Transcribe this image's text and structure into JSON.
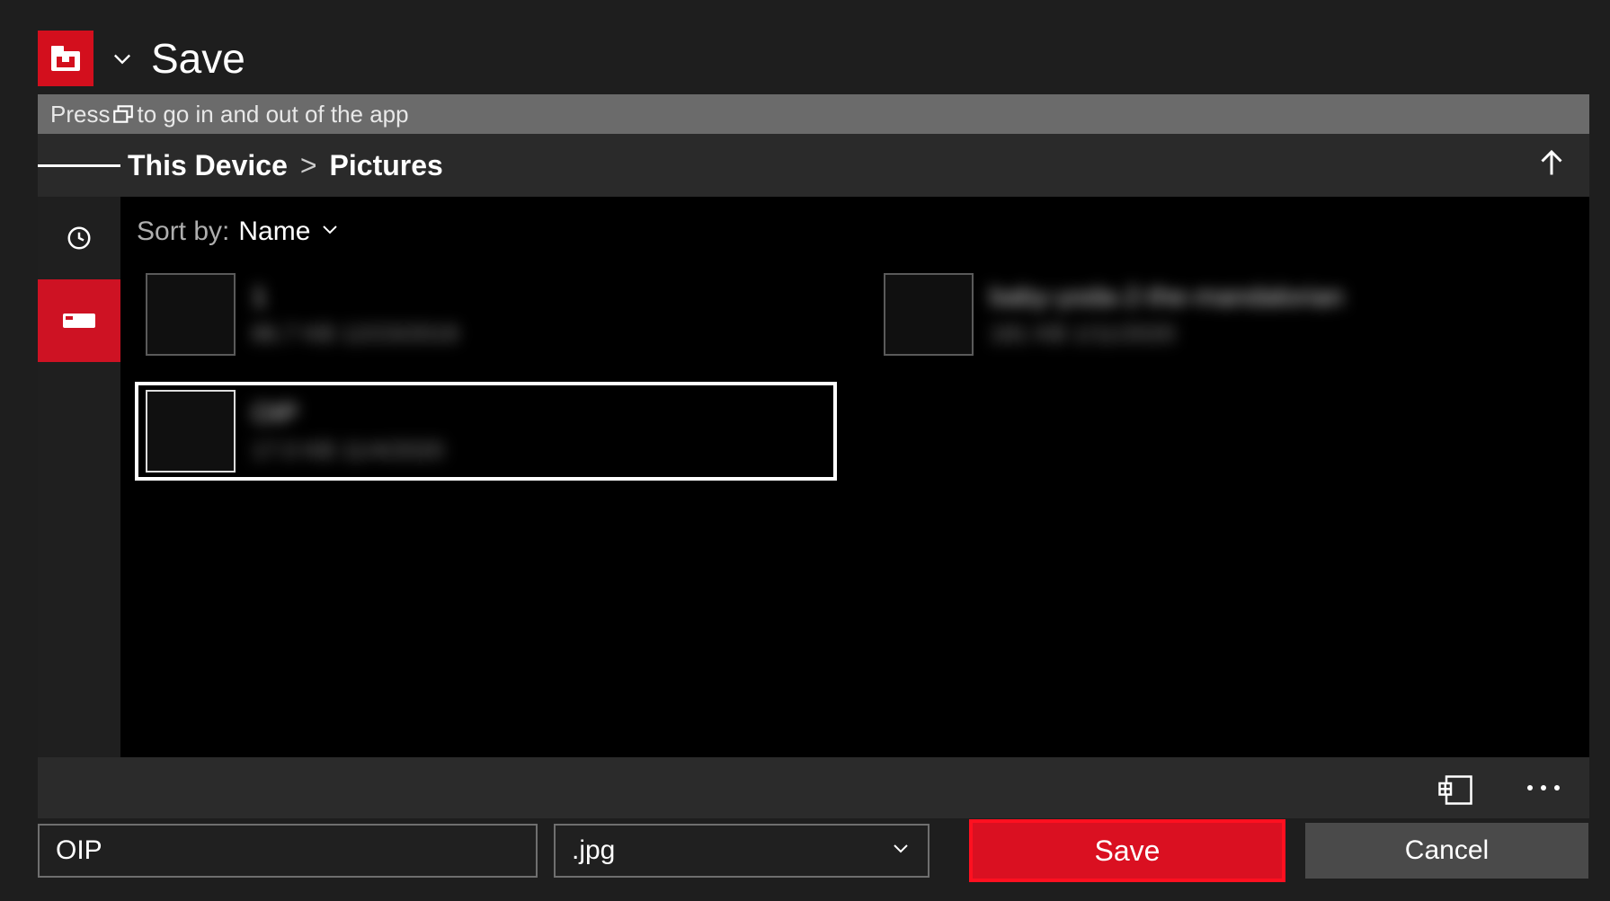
{
  "title": "Save",
  "hint": {
    "prefix": "Press",
    "suffix": "to go in and out of the app"
  },
  "breadcrumb": {
    "root": "This Device",
    "sep": ">",
    "leaf": "Pictures"
  },
  "sort": {
    "label": "Sort by:",
    "value": "Name"
  },
  "files": [
    {
      "name": "1",
      "sub": "86.7 KB  12/23/2019",
      "selected": false
    },
    {
      "name": "baby-yoda-2-the-mandalorian",
      "sub": "181 KB  1/11/2020",
      "selected": false
    },
    {
      "name": "OIP",
      "sub": "17.0 KB  11/4/2020",
      "selected": true
    }
  ],
  "footer": {
    "filename": "OIP",
    "extension": ".jpg",
    "save": "Save",
    "cancel": "Cancel"
  }
}
